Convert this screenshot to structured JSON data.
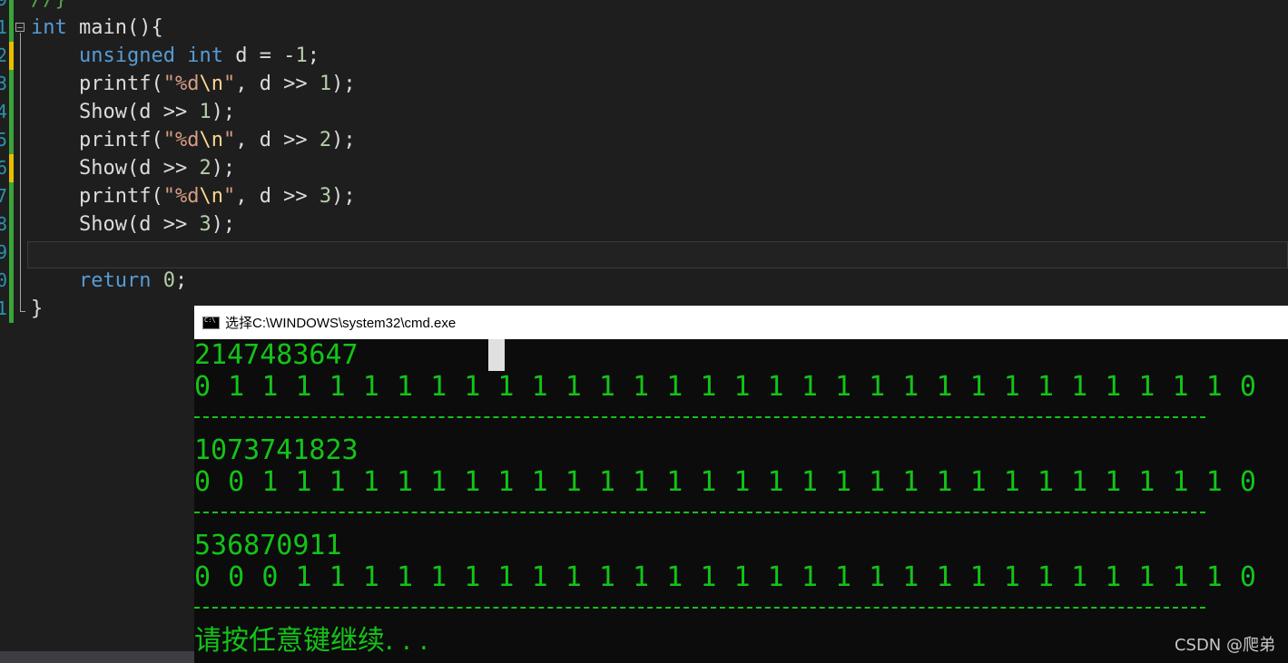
{
  "editor": {
    "line_numbers": [
      "9",
      "1",
      "2",
      "3",
      "4",
      "5",
      "6",
      "7",
      "8",
      "9",
      "0",
      "1"
    ],
    "lines": [
      [
        {
          "t": "//}",
          "c": "cmt"
        }
      ],
      [
        {
          "t": "int",
          "c": "kw"
        },
        {
          "t": " main(){",
          "c": "plain"
        }
      ],
      [
        {
          "t": "    ",
          "c": "plain"
        },
        {
          "t": "unsigned",
          "c": "kw"
        },
        {
          "t": " ",
          "c": "plain"
        },
        {
          "t": "int",
          "c": "kw"
        },
        {
          "t": " d = -",
          "c": "plain"
        },
        {
          "t": "1",
          "c": "num"
        },
        {
          "t": ";",
          "c": "plain"
        }
      ],
      [
        {
          "t": "    printf(",
          "c": "plain"
        },
        {
          "t": "\"%d",
          "c": "str"
        },
        {
          "t": "\\n",
          "c": "esc"
        },
        {
          "t": "\"",
          "c": "str"
        },
        {
          "t": ", d >> ",
          "c": "plain"
        },
        {
          "t": "1",
          "c": "num"
        },
        {
          "t": ");",
          "c": "plain"
        }
      ],
      [
        {
          "t": "    Show(d >> ",
          "c": "plain"
        },
        {
          "t": "1",
          "c": "num"
        },
        {
          "t": ");",
          "c": "plain"
        }
      ],
      [
        {
          "t": "    printf(",
          "c": "plain"
        },
        {
          "t": "\"%d",
          "c": "str"
        },
        {
          "t": "\\n",
          "c": "esc"
        },
        {
          "t": "\"",
          "c": "str"
        },
        {
          "t": ", d >> ",
          "c": "plain"
        },
        {
          "t": "2",
          "c": "num"
        },
        {
          "t": ");",
          "c": "plain"
        }
      ],
      [
        {
          "t": "    Show(d >> ",
          "c": "plain"
        },
        {
          "t": "2",
          "c": "num"
        },
        {
          "t": ");",
          "c": "plain"
        }
      ],
      [
        {
          "t": "    printf(",
          "c": "plain"
        },
        {
          "t": "\"%d",
          "c": "str"
        },
        {
          "t": "\\n",
          "c": "esc"
        },
        {
          "t": "\"",
          "c": "str"
        },
        {
          "t": ", d >> ",
          "c": "plain"
        },
        {
          "t": "3",
          "c": "num"
        },
        {
          "t": ");",
          "c": "plain"
        }
      ],
      [
        {
          "t": "    Show(d >> ",
          "c": "plain"
        },
        {
          "t": "3",
          "c": "num"
        },
        {
          "t": ");",
          "c": "plain"
        }
      ],
      [
        {
          "t": "",
          "c": "plain"
        }
      ],
      [
        {
          "t": "    ",
          "c": "plain"
        },
        {
          "t": "return",
          "c": "kw"
        },
        {
          "t": " ",
          "c": "plain"
        },
        {
          "t": "0",
          "c": "num"
        },
        {
          "t": ";",
          "c": "plain"
        }
      ],
      [
        {
          "t": "}",
          "c": "plain"
        }
      ]
    ],
    "change_markers": [
      "green",
      "green",
      "yellow",
      "green",
      "green",
      "green",
      "yellow",
      "green",
      "green",
      "green",
      "green",
      "green"
    ]
  },
  "console": {
    "title": "选择C:\\WINDOWS\\system32\\cmd.exe",
    "blocks": [
      {
        "value": "2147483647",
        "bits": "0 1 1 1 1 1 1 1 1 1 1 1 1 1 1 1 1 1 1 1 1 1 1 1 1 1 1 1 1 1 1 0"
      },
      {
        "value": "1073741823",
        "bits": "0 0 1 1 1 1 1 1 1 1 1 1 1 1 1 1 1 1 1 1 1 1 1 1 1 1 1 1 1 1 1 0"
      },
      {
        "value": "536870911",
        "bits": "0 0 0 1 1 1 1 1 1 1 1 1 1 1 1 1 1 1 1 1 1 1 1 1 1 1 1 1 1 1 1 0"
      }
    ],
    "prompt": "请按任意键继续. . ."
  },
  "watermark": "CSDN @爬弟",
  "colors": {
    "editor_bg": "#1e1e1e",
    "console_bg": "#0c0c0c",
    "console_text": "#13c418",
    "keyword": "#569cd6",
    "string": "#d69d85",
    "number": "#b5cea8",
    "line_number": "#2b91af"
  },
  "icons": {
    "console": "cmd-icon",
    "fold": "collapse-toggle-icon"
  }
}
